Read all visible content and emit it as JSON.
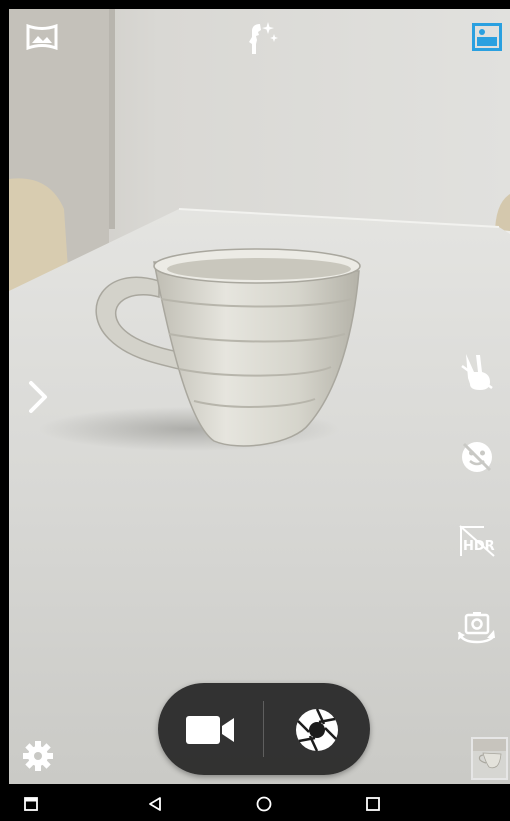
{
  "camera": {
    "top_bar": {
      "panorama_icon": "panorama-icon",
      "beauty_icon": "beauty-icon",
      "gallery_icon": "gallery-icon"
    },
    "side_controls": {
      "expand_icon": "chevron-right-icon",
      "gesture_icon": "gesture-shot-icon",
      "face_icon": "face-beauty-off-icon",
      "hdr_label": "HDR",
      "switch_camera_icon": "switch-camera-icon"
    },
    "bottom_bar": {
      "settings_icon": "gear-icon",
      "video_icon": "video-camera-icon",
      "shutter_icon": "shutter-icon",
      "thumbnail": "last-photo-thumbnail"
    }
  },
  "navigation_bar": {
    "recents_icon": "recents-icon",
    "back_icon": "back-icon",
    "home_icon": "home-icon",
    "overview_icon": "overview-icon"
  },
  "colors": {
    "accent": "#2aa0e0",
    "icon": "#ffffff",
    "pill": "#1c1c1c"
  }
}
